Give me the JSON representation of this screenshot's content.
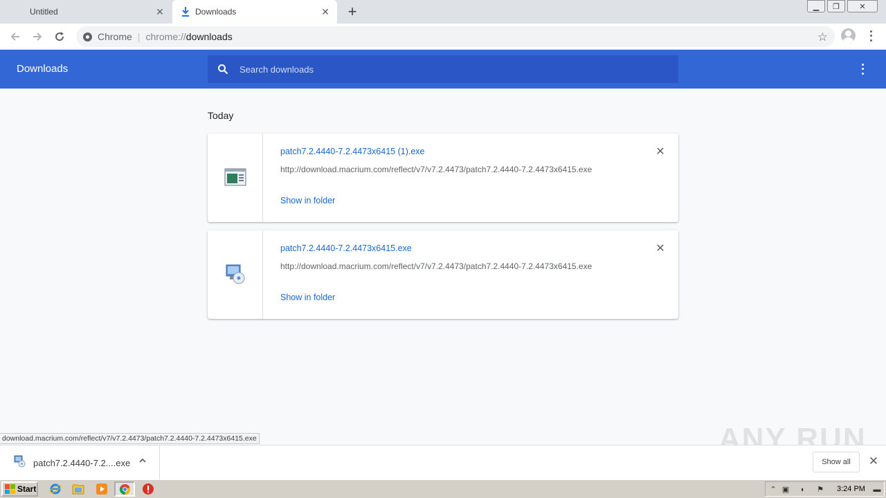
{
  "browser": {
    "tabs": [
      {
        "title": "Untitled",
        "active": false
      },
      {
        "title": "Downloads",
        "active": true
      }
    ],
    "new_tab_symbol": "+",
    "window_controls": [
      "minimize",
      "restore",
      "close"
    ],
    "omnibox": {
      "chip": "Chrome",
      "scheme": "chrome://",
      "path": "downloads"
    }
  },
  "downloads_page": {
    "title": "Downloads",
    "search_placeholder": "Search downloads",
    "section_title": "Today",
    "items": [
      {
        "file_name": "patch7.2.4440-7.2.4473x6415 (1).exe",
        "url": "http://download.macrium.com/reflect/v7/v7.2.4473/patch7.2.4440-7.2.4473x6415.exe",
        "action": "Show in folder",
        "icon": "window-app-icon"
      },
      {
        "file_name": "patch7.2.4440-7.2.4473x6415.exe",
        "url": "http://download.macrium.com/reflect/v7/v7.2.4473/patch7.2.4440-7.2.4473x6415.exe",
        "action": "Show in folder",
        "icon": "installer-disc-icon"
      }
    ]
  },
  "status_bubble": "download.macrium.com/reflect/v7/v7.2.4473/patch7.2.4440-7.2.4473x6415.exe",
  "download_shelf": {
    "item_name": "patch7.2.4440-7.2....exe",
    "show_all_label": "Show all"
  },
  "watermark": "ANY RUN",
  "taskbar": {
    "start_label": "Start",
    "pinned": [
      "ie-icon",
      "explorer-folder-icon",
      "media-player-icon",
      "chrome-icon",
      "antivirus-stop-icon"
    ],
    "clock": "3:24 PM"
  },
  "colors": {
    "header_blue": "#3367d6",
    "search_blue": "#2a56c6",
    "link_blue": "#1967d2",
    "page_bg": "#f8f9fa"
  }
}
